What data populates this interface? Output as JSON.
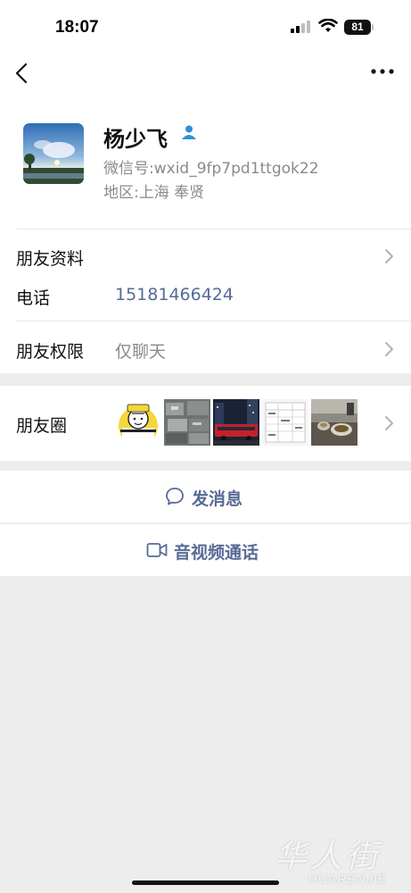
{
  "status_bar": {
    "time": "18:07",
    "battery": "81"
  },
  "profile": {
    "name": "杨少飞",
    "wxid_label": "微信号:",
    "wxid": "wxid_9fp7pd1ttgok22",
    "region_label": "地区:",
    "region": "上海 奉贤"
  },
  "rows": {
    "friend_info": "朋友资料",
    "phone_label": "电话",
    "phone": "15181466424",
    "permissions_label": "朋友权限",
    "permissions_value": "仅聊天",
    "moments_label": "朋友圈"
  },
  "actions": {
    "message": "发消息",
    "video_call": "音视频通话"
  },
  "watermark": {
    "chinese": "华人街",
    "latin": "HUARENJIE"
  },
  "colors": {
    "link_blue": "#576b95",
    "background": "#ededed"
  }
}
